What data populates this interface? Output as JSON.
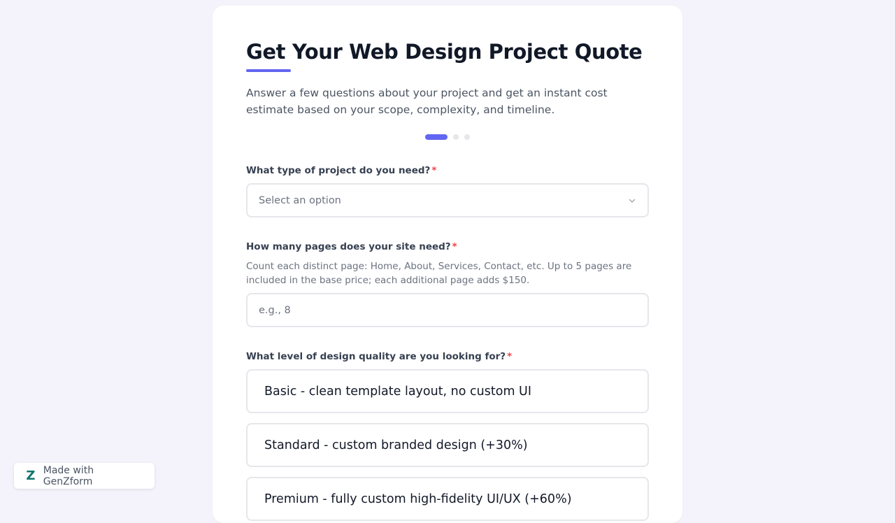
{
  "form": {
    "title": "Get Your Web Design Project Quote",
    "subtitle": "Answer a few questions about your project and get an instant cost estimate based on your scope, complexity, and timeline.",
    "steps": {
      "total": 3,
      "current": 1
    },
    "accent_color": "#6366f1",
    "required_marker": "*",
    "questions": {
      "project_type": {
        "label": "What type of project do you need?",
        "placeholder": "Select an option",
        "icon": "chevron-down-icon"
      },
      "pages": {
        "label": "How many pages does your site need?",
        "help": "Count each distinct page: Home, About, Services, Contact, etc. Up to 5 pages are included in the base price; each additional page adds $150.",
        "placeholder": "e.g., 8"
      },
      "design_level": {
        "label": "What level of design quality are you looking for?",
        "options": [
          "Basic - clean template layout, no custom UI",
          "Standard - custom branded design (+30%)",
          "Premium - fully custom high-fidelity UI/UX (+60%)"
        ]
      }
    }
  },
  "badge": {
    "logo_letter": "Z",
    "logo_color": "#0f766e",
    "text": "Made with GenZform"
  }
}
